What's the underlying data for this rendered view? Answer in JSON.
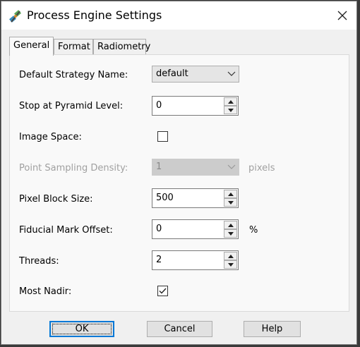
{
  "window": {
    "title": "Process Engine Settings",
    "app_icon": "satellite-icon",
    "close_icon": "close-icon"
  },
  "tabs": [
    {
      "label": "General",
      "active": true
    },
    {
      "label": "Format",
      "active": false
    },
    {
      "label": "Radiometry",
      "active": false
    }
  ],
  "fields": {
    "strategy": {
      "label": "Default Strategy Name:",
      "value": "default"
    },
    "pyramid": {
      "label": "Stop at Pyramid Level:",
      "value": "0"
    },
    "image_space": {
      "label": "Image Space:",
      "checked": false
    },
    "sampling": {
      "label": "Point Sampling Density:",
      "value": "1",
      "unit": "pixels",
      "enabled": false
    },
    "block_size": {
      "label": "Pixel Block Size:",
      "value": "500"
    },
    "fiducial": {
      "label": "Fiducial Mark Offset:",
      "value": "0",
      "unit": "%"
    },
    "threads": {
      "label": "Threads:",
      "value": "2"
    },
    "most_nadir": {
      "label": "Most Nadir:",
      "checked": true
    }
  },
  "buttons": {
    "ok": "OK",
    "cancel": "Cancel",
    "help": "Help"
  },
  "colors": {
    "accent": "#0078d7",
    "disabled_text": "#a0a0a0"
  }
}
